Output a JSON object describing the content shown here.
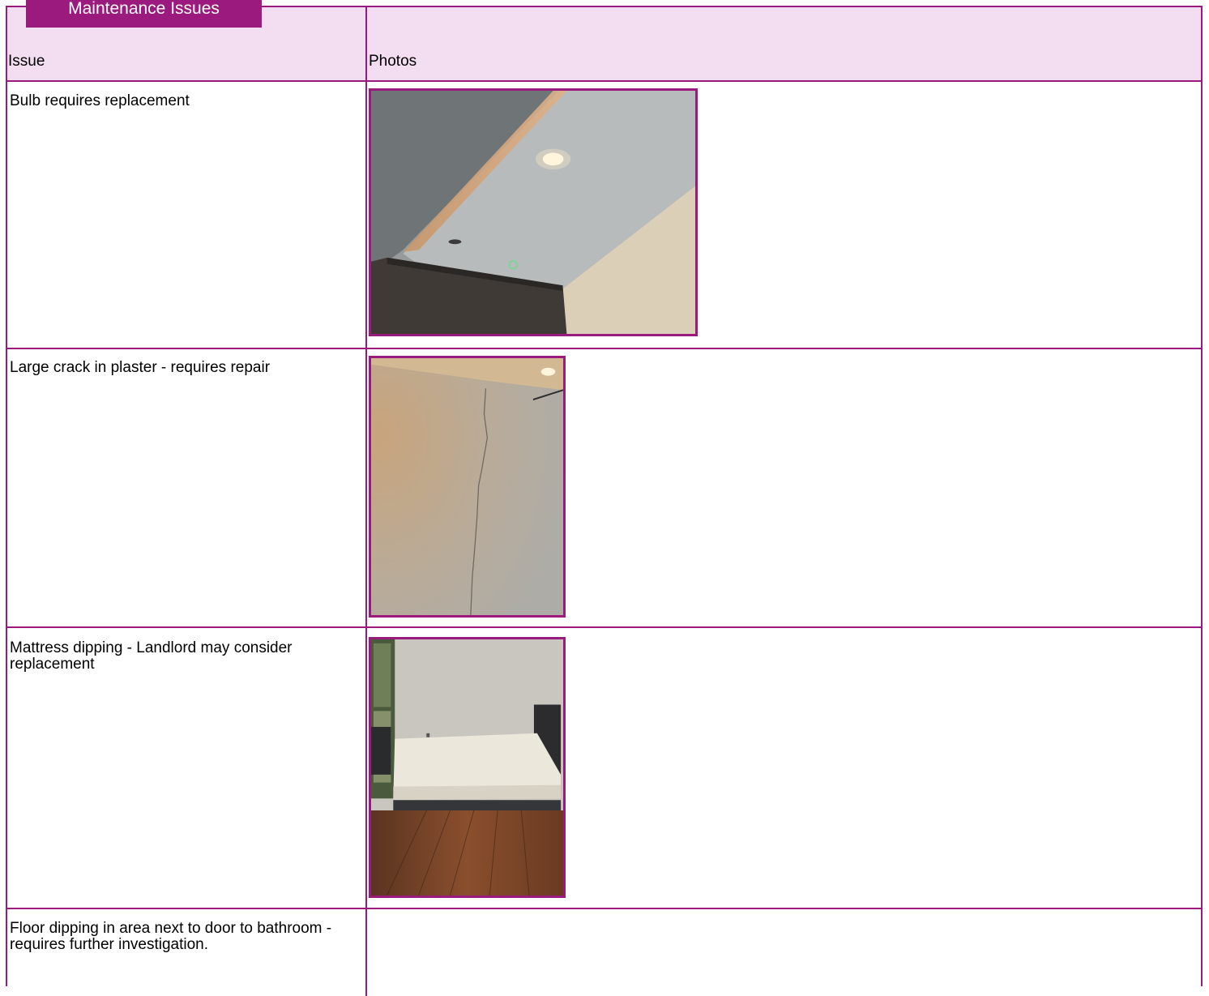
{
  "section": {
    "title": "Maintenance Issues"
  },
  "table": {
    "headers": {
      "issue": "Issue",
      "photos": "Photos"
    },
    "rows": [
      {
        "issue": "Bulb requires replacement",
        "photo": "ceiling-bulb-photo"
      },
      {
        "issue": "Large crack in plaster - requires repair",
        "photo": "wall-crack-photo"
      },
      {
        "issue": "Mattress dipping - Landlord may consider replacement",
        "photo": "mattress-photo"
      },
      {
        "issue": "Floor dipping in area next to door to bathroom - requires further investigation.",
        "photo": ""
      }
    ]
  },
  "colors": {
    "accent": "#9b1a7d",
    "header_bg": "#f3ddf0"
  }
}
